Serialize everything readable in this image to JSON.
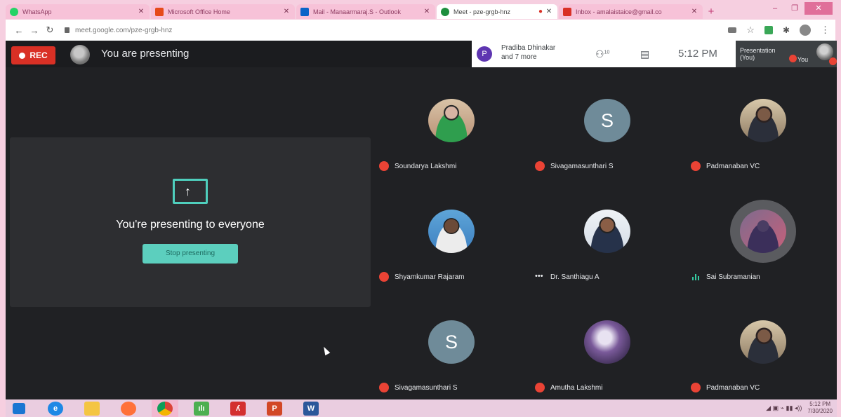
{
  "browser": {
    "tabs": [
      {
        "title": "WhatsApp",
        "color": "#25d366"
      },
      {
        "title": "Microsoft Office Home",
        "color": "#e64a19"
      },
      {
        "title": "Mail - Manaarmaraj.S - Outlook",
        "color": "#0a64c8"
      },
      {
        "title": "Meet - pze-grgb-hnz",
        "color": "#1e8e3e"
      },
      {
        "title": "Inbox - amalaistaice@gmail.co",
        "color": "#d93025"
      }
    ],
    "new_tab": "+",
    "minimize": "–",
    "maximize": "❐",
    "close": "✕",
    "url": "meet.google.com/pze-grgb-hnz"
  },
  "meet": {
    "rec_label": "REC",
    "presenting_label": "You are presenting",
    "participants_summary": {
      "avatar_letter": "P",
      "line1": "Pradiba Dhinakar",
      "line2": "and 7 more"
    },
    "people_count": "10",
    "time": "5:12 PM",
    "presentation_thumb": {
      "line1": "Presentation",
      "line2": "(You)"
    },
    "you_label": "You",
    "presenting_message": "You're presenting to everyone",
    "stop_button": "Stop presenting",
    "accent_color": "#5ccfbe"
  },
  "participants": [
    {
      "name": "Soundarya Lakshmi",
      "status": "muted",
      "avatar": "photo"
    },
    {
      "name": "Sivagamasunthari S",
      "status": "muted",
      "avatar": "S"
    },
    {
      "name": "Padmanaban VC",
      "status": "muted",
      "avatar": "photo"
    },
    {
      "name": "Shyamkumar Rajaram",
      "status": "muted",
      "avatar": "photo"
    },
    {
      "name": "Dr. Santhiagu A",
      "status": "more",
      "avatar": "photo"
    },
    {
      "name": "Sai Subramanian",
      "status": "speaking",
      "avatar": "photo"
    },
    {
      "name": "Sivagamasunthari S",
      "status": "muted",
      "avatar": "S"
    },
    {
      "name": "Amutha Lakshmi",
      "status": "muted",
      "avatar": "photo"
    },
    {
      "name": "Padmanaban VC",
      "status": "muted",
      "avatar": "photo"
    }
  ],
  "taskbar": {
    "apps": [
      "start",
      "internet-explorer",
      "file-explorer",
      "firefox",
      "chrome",
      "excel-like",
      "acrobat",
      "powerpoint",
      "word"
    ],
    "clock_time": "5:12 PM",
    "clock_date": "7/30/2020"
  }
}
